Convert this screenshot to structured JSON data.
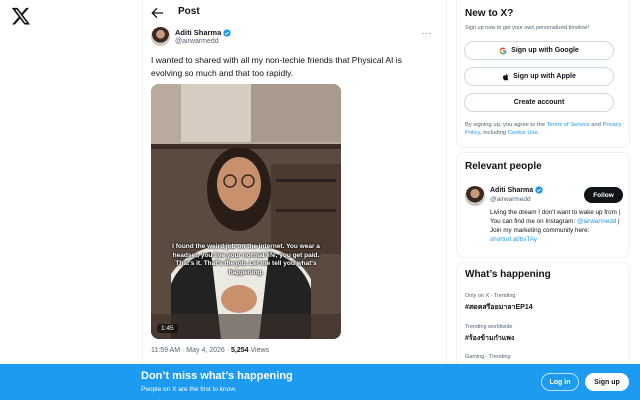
{
  "nav": {
    "logo_icon": "x-logo-icon"
  },
  "post": {
    "header_title": "Post",
    "author": {
      "name": "Aditi Sharma",
      "handle": "@airwarmedd",
      "verified": true
    },
    "more_label": "···",
    "text": "I wanted to shared with all my non-techie friends that Physical AI is evolving so much and that too rapidly.",
    "video": {
      "caption": "I found the weird job on the internet. You wear a headset, you live your normal life, you get paid. That's it. That's the job. Let me tell you what's happening.",
      "duration": "1:45"
    },
    "meta": {
      "time": "11:59 AM · May 4, 2026 · ",
      "views_count": "5,254",
      "views_label": " Views"
    }
  },
  "new_to_x": {
    "title": "New to X?",
    "subtitle": "Sign up now to get your own personalized timeline!",
    "google_label": "Sign up with Google",
    "apple_label": "Sign up with Apple",
    "create_label": "Create account",
    "terms_prefix": "By signing up, you agree to the ",
    "terms_link": "Terms of Service",
    "terms_and": " and ",
    "privacy_link": "Privacy Policy",
    "terms_including": ", including ",
    "cookie_link": "Cookie Use",
    "terms_end": "."
  },
  "relevant_people": {
    "title": "Relevant people",
    "person": {
      "name": "Aditi Sharma",
      "handle": "@airwarmedd",
      "follow_label": "Follow",
      "bio_1": "Living the dream I don't want to wake up from | You can find me on Instagram: ",
      "bio_link_1": "@airwarmedd",
      "bio_2": " | Join my marketing community here: ",
      "bio_link_2": "shorturl.at/bsTAy"
    }
  },
  "happening": {
    "title": "What’s happening",
    "trends": [
      {
        "context": "Only on X · Trending",
        "name": "#สดคสรีอยมาลาEP14"
      },
      {
        "context": "Trending worldwide",
        "name": "#ร้องข้ามกำแพง"
      },
      {
        "context": "Gaming · Trending",
        "name": ""
      }
    ]
  },
  "banner": {
    "title": "Don’t miss what’s happening",
    "subtitle": "People on X are the first to know.",
    "login_label": "Log in",
    "signup_label": "Sign up"
  },
  "colors": {
    "accent": "#1d9bf0",
    "text": "#0f1419",
    "muted": "#536471",
    "border": "#eff3f4"
  }
}
